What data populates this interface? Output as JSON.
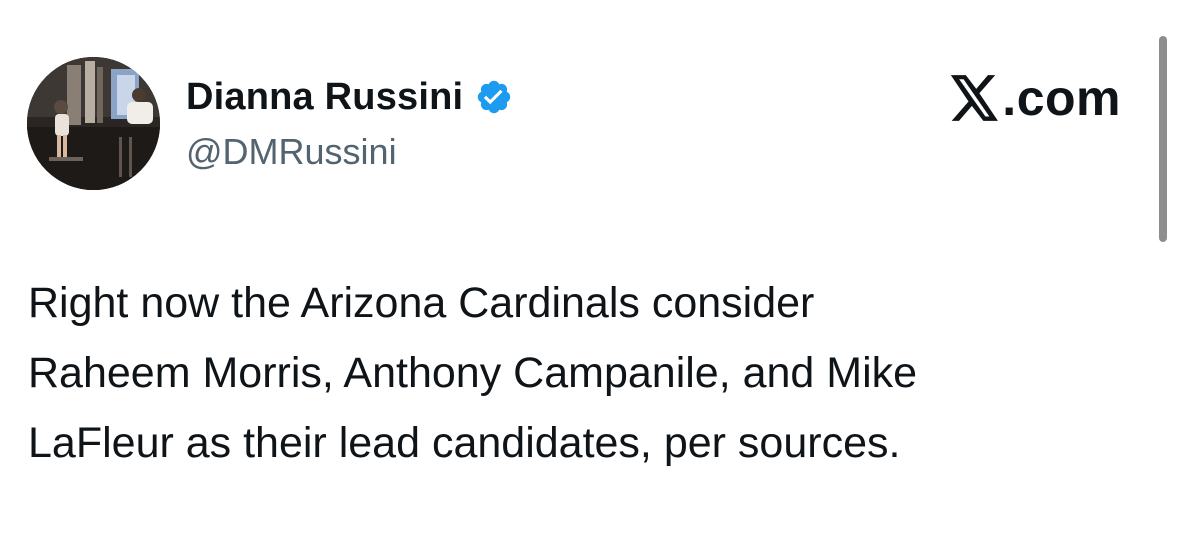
{
  "author": {
    "display_name": "Dianna Russini",
    "handle": "@DMRussini",
    "verified": true,
    "avatar_icon": "avatar-photo"
  },
  "brand": {
    "label": ".com",
    "icon": "x-logo-icon"
  },
  "tweet": {
    "text": "Right now the Arizona Cardinals consider\nRaheem Morris, Anthony Campanile, and Mike\nLaFleur as their lead candidates, per sources."
  },
  "colors": {
    "text_primary": "#0f1419",
    "text_secondary": "#536471",
    "verified_blue": "#1d9bf0",
    "background": "#ffffff"
  }
}
